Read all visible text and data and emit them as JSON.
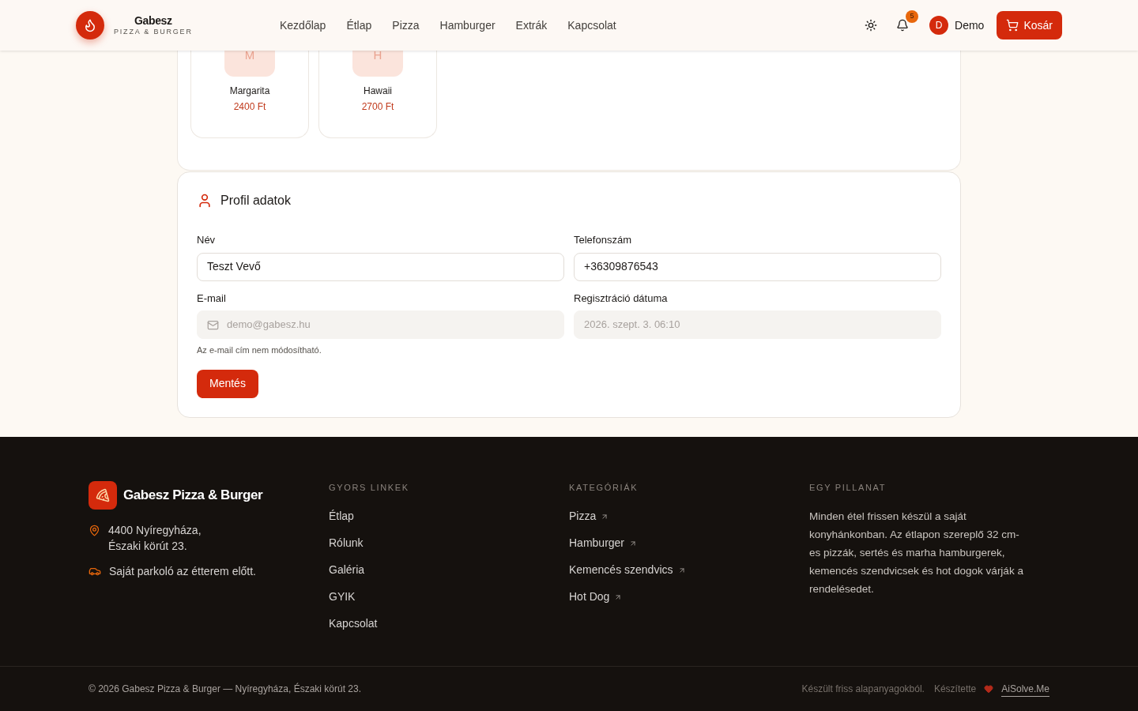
{
  "header": {
    "brand": "Gabesz",
    "tagline": "PIZZA & BURGER",
    "nav": [
      {
        "label": "Kezdőlap",
        "selected": false
      },
      {
        "label": "Étlap",
        "selected": false
      },
      {
        "label": "Pizza",
        "selected": false
      },
      {
        "label": "Hamburger",
        "selected": false
      },
      {
        "label": "Extrák",
        "selected": false
      },
      {
        "label": "Kapcsolat",
        "selected": false
      }
    ],
    "notifications": "5",
    "user_initial": "D",
    "user_name": "Demo",
    "cart": "Kosár"
  },
  "products": [
    {
      "initial": "M",
      "name": "Margarita",
      "price": "2400 Ft"
    },
    {
      "initial": "H",
      "name": "Hawaii",
      "price": "2700 Ft"
    }
  ],
  "profile": {
    "title": "Profil adatok",
    "fields": [
      {
        "label": "Név",
        "value": "Teszt Vevő",
        "disabled": false
      },
      {
        "label": "Telefonszám",
        "value": "+36309876543",
        "disabled": false
      },
      {
        "label": "E-mail",
        "value": "demo@gabesz.hu",
        "disabled": true,
        "kind": "email"
      },
      {
        "label": "Regisztráció dátuma",
        "value": "2026. szept. 3. 06:10",
        "disabled": true
      }
    ],
    "email_note": "Az e-mail cím nem módosítható.",
    "save": "Mentés"
  },
  "footer": {
    "brand": "Gabesz Pizza & Burger",
    "address_lines": [
      "4400 Nyíregyháza,",
      "Északi körút 23."
    ],
    "parking": "Saját parkoló az étterem előtt.",
    "quick_links_title": "GYORS LINKEK",
    "quick_links": [
      "Étlap",
      "Rólunk",
      "Galéria",
      "GYIK",
      "Kapcsolat"
    ],
    "categories_title": "KATEGÓRIÁK",
    "categories": [
      "Pizza",
      "Hamburger",
      "Kemencés szendvics",
      "Hot Dog"
    ],
    "about_title": "EGY PILLANAT",
    "about": "Minden étel frissen készül a saját konyhánkonban. Az étlapon szereplő 32 cm-es pizzák, sertés és marha hamburgerek, kemencés szendvicsek és hot dogok várják a rendelésedet.",
    "copyright": "© 2026 Gabesz Pizza & Burger — Nyíregyháza, Északi körút 23.",
    "made_with": "Készült friss alapanyagokból.",
    "made_by": "Készítette",
    "made_by_link": "AiSolve.Me"
  }
}
